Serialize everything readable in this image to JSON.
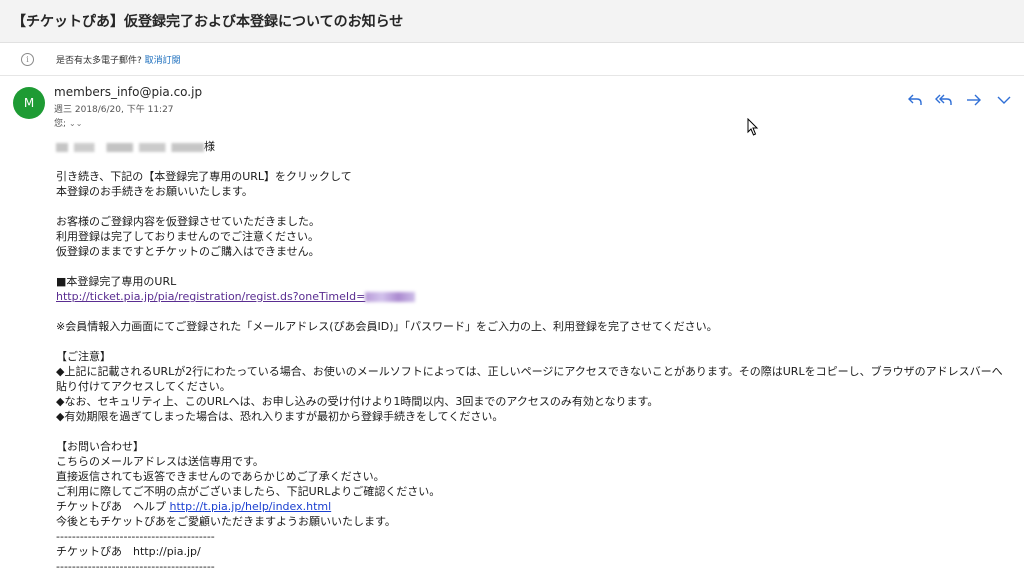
{
  "subject": "【チケットぴあ】仮登録完了および本登録についてのお知らせ",
  "unsubscribe": {
    "prompt": "是否有太多電子郵件? ",
    "link": "取消訂閱"
  },
  "sender": {
    "avatar_letter": "M",
    "avatar_color": "#1e9b34",
    "email": "members_info@pia.co.jp",
    "date": "週三 2018/6/20, 下午 11:27",
    "to": "您;"
  },
  "actions": {
    "icons": [
      "reply-icon",
      "reply-all-icon",
      "forward-icon",
      "more-icon"
    ],
    "color": "#2f6fd6"
  },
  "body": {
    "salutation_suffix": "様",
    "p1": [
      "引き続き、下記の【本登録完了専用のURL】をクリックして",
      "本登録のお手続きをお願いいたします。"
    ],
    "p2": [
      "お客様のご登録内容を仮登録させていただきました。",
      "利用登録は完了しておりませんのでご注意ください。",
      "仮登録のままですとチケットのご購入はできません。"
    ],
    "url_heading": "■本登録完了専用のURL",
    "url": "http://ticket.pia.jp/pia/registration/regist.ds?oneTimeId=",
    "notice1": "※会員情報入力画面にてご登録された「メールアドレス(ぴあ会員ID)」「パスワード」をご入力の上、利用登録を完了させてください。",
    "caution_heading": "【ご注意】",
    "caution": [
      "◆上記に記載されるURLが2行にわたっている場合、お使いのメールソフトによっては、正しいページにアクセスできないことがあります。その際はURLをコピーし、ブラウザのアドレスバーへ貼り付けてアクセスしてください。",
      "◆なお、セキュリティ上、このURLへは、お申し込みの受け付けより1時間以内、3回までのアクセスのみ有効となります。",
      "◆有効期限を過ぎてしまった場合は、恐れ入りますが最初から登録手続きをしてください。"
    ],
    "contact_heading": "【お問い合わせ】",
    "contact": [
      "こちらのメールアドレスは送信専用です。",
      "直接返信されても返答できませんのであらかじめご了承ください。",
      "ご利用に際してご不明の点がございましたら、下記URLよりご確認ください。"
    ],
    "help_prefix": "チケットぴあ　ヘルプ ",
    "help_url": "http://t.pia.jp/help/index.html",
    "closing": "今後ともチケットぴあをご愛顧いただきますようお願いいたします。",
    "separator": "----------------------------------------",
    "footer": "チケットぴあ　http://pia.jp/"
  }
}
